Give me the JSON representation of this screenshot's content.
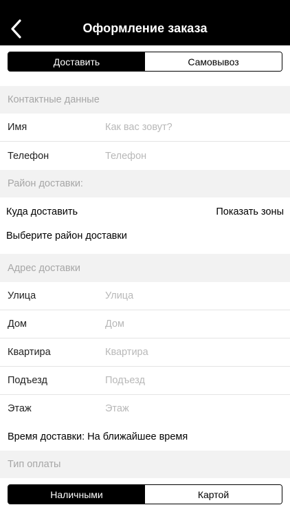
{
  "header": {
    "title": "Оформление заказа"
  },
  "delivery_mode": {
    "options": [
      "Доставить",
      "Самовывоз"
    ],
    "selected": "Доставить"
  },
  "sections": {
    "contacts": "Контактные данные",
    "district": "Район доставки:",
    "address": "Адрес доставки",
    "payment": "Тип оплаты"
  },
  "contacts": {
    "name": {
      "label": "Имя",
      "placeholder": "Как вас зовут?"
    },
    "phone": {
      "label": "Телефон",
      "placeholder": "Телефон"
    }
  },
  "district": {
    "where_label": "Куда доставить",
    "show_zones": "Показать зоны",
    "choose": "Выберите район доставки"
  },
  "address": {
    "street": {
      "label": "Улица",
      "placeholder": "Улица"
    },
    "house": {
      "label": "Дом",
      "placeholder": "Дом"
    },
    "apartment": {
      "label": "Квартира",
      "placeholder": "Квартира"
    },
    "entrance": {
      "label": "Подъезд",
      "placeholder": "Подъезд"
    },
    "floor": {
      "label": "Этаж",
      "placeholder": "Этаж"
    }
  },
  "delivery_time": "Время доставки: На ближайшее время",
  "payment": {
    "options": [
      "Наличными",
      "Картой"
    ],
    "selected": "Наличными"
  }
}
